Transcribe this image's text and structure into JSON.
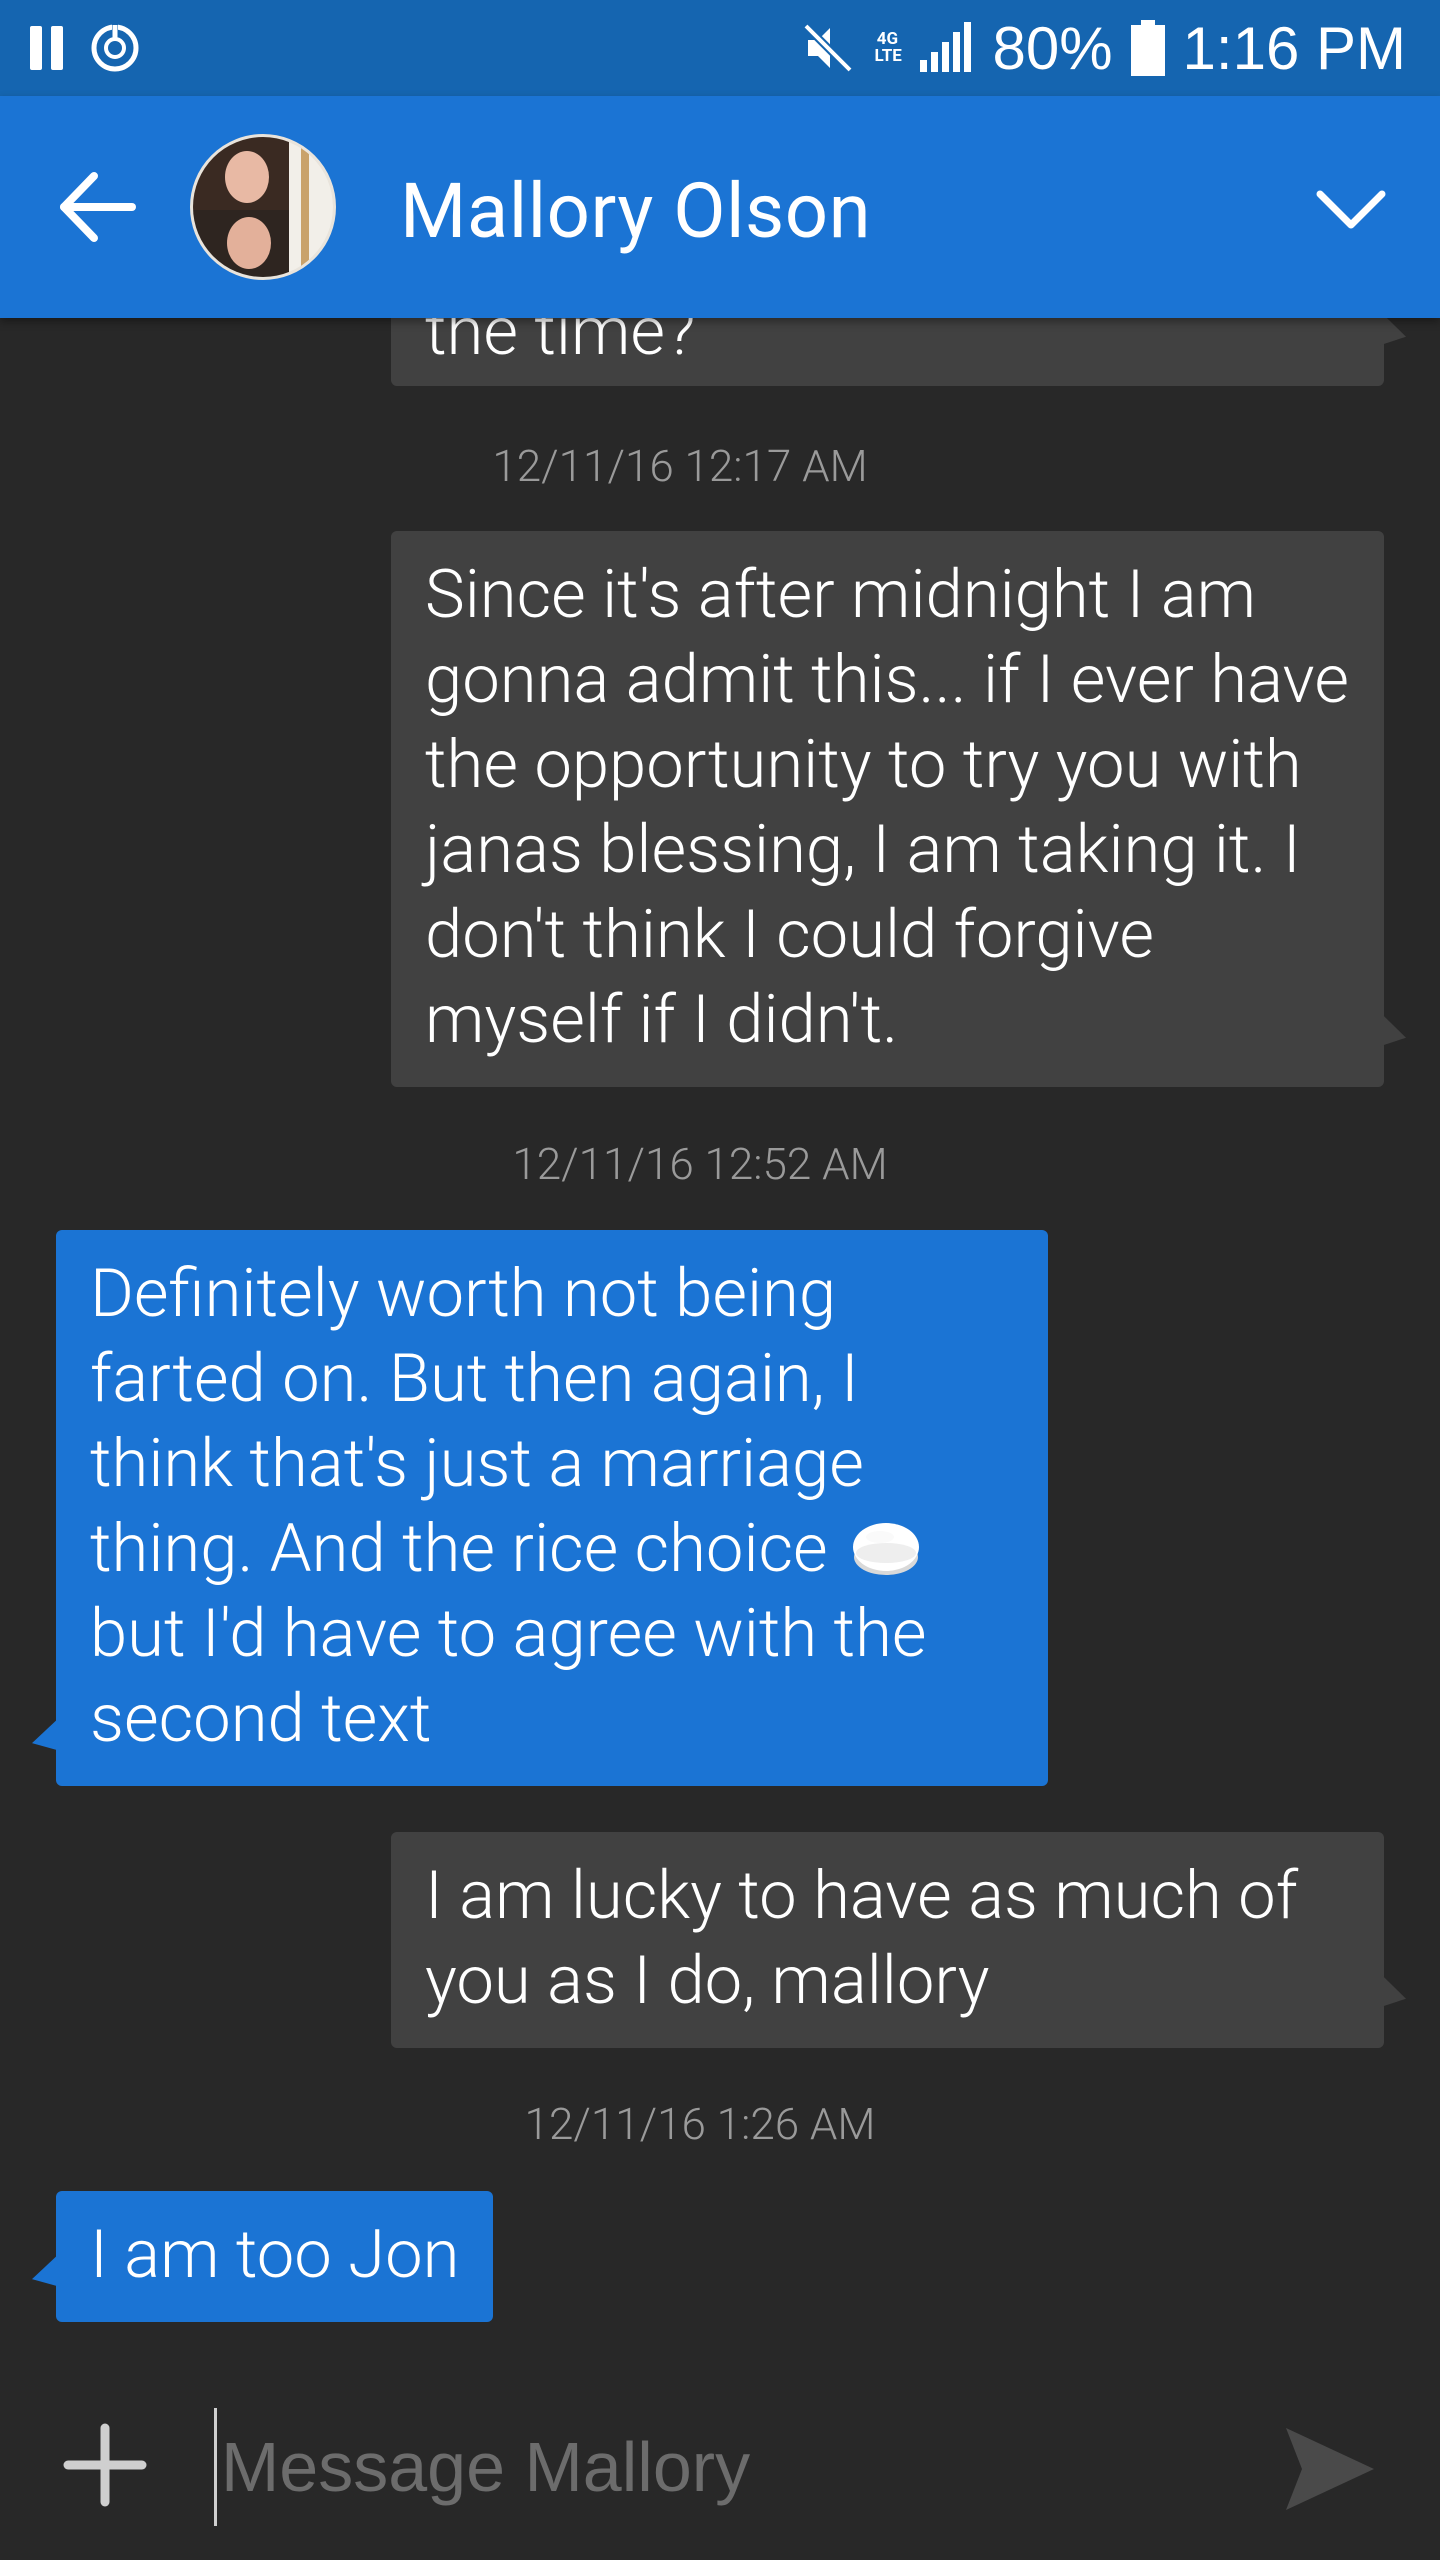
{
  "status_bar": {
    "network": "4G LTE",
    "battery": "80%",
    "time": "1:16 PM"
  },
  "header": {
    "contact_name": "Mallory Olson"
  },
  "messages": [
    {
      "type": "outgoing",
      "text": "the time?"
    },
    {
      "type": "timestamp",
      "text": "12/11/16 12:17 AM"
    },
    {
      "type": "outgoing",
      "text": "Since it's after midnight I am gonna admit this... if I ever have the opportunity to try you with janas blessing, I am taking it. I don't think I could forgive myself if I didn't."
    },
    {
      "type": "timestamp",
      "text": "12/11/16 12:52 AM"
    },
    {
      "type": "incoming",
      "text_before_emoji": "Definitely worth not being farted on. But then again, I think that's just a marriage thing. And the rice choice",
      "emoji": "rice-ball-emoji",
      "text_after_emoji": "but I'd have to agree with the second text"
    },
    {
      "type": "outgoing",
      "text": "I am lucky to have as much of you as I do, mallory"
    },
    {
      "type": "timestamp",
      "text": "12/11/16 1:26 AM"
    },
    {
      "type": "incoming",
      "text": "I am too Jon"
    }
  ],
  "composer": {
    "placeholder": "Message Mallory",
    "plus_icon": "plus-icon",
    "send_icon": "send-icon"
  },
  "colors": {
    "status_bar": "#1565b0",
    "app_bar": "#1b74d4",
    "background": "#282828",
    "outgoing_bubble": "#414141",
    "incoming_bubble": "#1b74d4",
    "timestamp_text": "#9a9a9a"
  }
}
